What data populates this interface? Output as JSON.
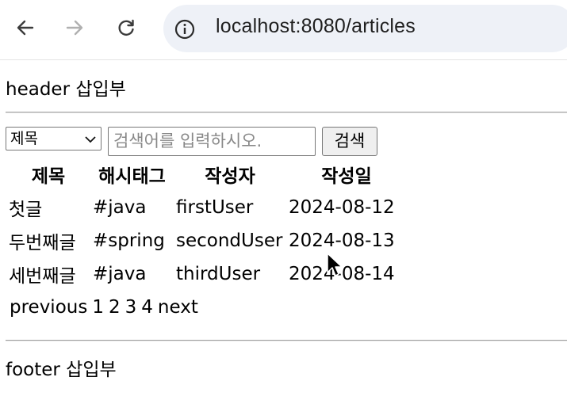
{
  "browser": {
    "url": "localhost:8080/articles",
    "icons": [
      "back-arrow-icon",
      "forward-arrow-icon",
      "reload-icon",
      "info-icon"
    ]
  },
  "header": {
    "text": "header 삽입부"
  },
  "search": {
    "select_value": "제목",
    "placeholder": "검색어를 입력하시오.",
    "button_label": "검색"
  },
  "table": {
    "columns": [
      "제목",
      "해시태그",
      "작성자",
      "작성일"
    ],
    "rows": [
      [
        "첫글",
        "#java",
        "firstUser",
        "2024-08-12"
      ],
      [
        "두번째글",
        "#spring",
        "secondUser",
        "2024-08-13"
      ],
      [
        "세번째글",
        "#java",
        "thirdUser",
        "2024-08-14"
      ]
    ]
  },
  "pagination": {
    "previous": "previous",
    "pages": [
      "1",
      "2",
      "3",
      "4"
    ],
    "next": "next"
  },
  "footer": {
    "text": "footer 삽입부"
  }
}
